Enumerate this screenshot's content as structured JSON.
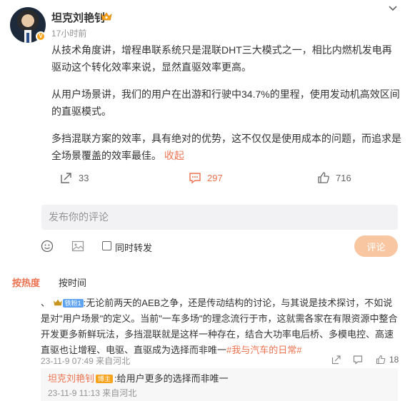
{
  "post": {
    "author": "坦克刘艳钊",
    "timestamp": "17小时前",
    "paragraphs": [
      "从技术角度讲，增程串联系统只是混联DHT三大模式之一，相比内燃机发电再驱动这个转化效率来说，显然直驱效率更高。",
      "从用户场景讲，我们的用户在出游和行驶中34.7%的里程，使用发动机高效区间的直驱模式。",
      "多挡混联方案的效率，具有绝对的优势，这不仅仅是使用成本的问题，而追求是全场景覆盖的效率最佳。"
    ],
    "collapse_label": "收起"
  },
  "actions": {
    "repost_count": "33",
    "comment_count": "297",
    "like_count": "716"
  },
  "composer": {
    "placeholder": "发布你的评论",
    "repost_label": "同时转发",
    "submit_label": "评论"
  },
  "sort": {
    "hot_label": "按热度",
    "time_label": "按时间"
  },
  "comment": {
    "prefix": "、",
    "fans_badge": "铁粉1",
    "text": ":无论前两天的AEB之争，还是传动结构的讨论，与其说是技术探讨，不如说是对\"用户场景\"的定义。当前\"一车多场\"的理念流行于市，这就需各家在有限资源中整合开发更多新鲜玩法，多挡混联就是这样一种存在，结合大功率电后桥、多模电控、高速直驱也让增程、电驱、直驱成为选择而非唯一",
    "hashtag": "#我与汽车的日常#",
    "meta": "23-11-9 07:49 来自河北",
    "like_count": "18"
  },
  "reply": {
    "author": "坦克刘艳钊",
    "author_badge": "博主",
    "text": ":给用户更多的选择而非唯一",
    "meta": "23-11-9 11:13 来自河北"
  },
  "colors": {
    "accent": "#eb7350",
    "gold": "#f7a21b",
    "submit_bg": "#f8c7a2"
  }
}
